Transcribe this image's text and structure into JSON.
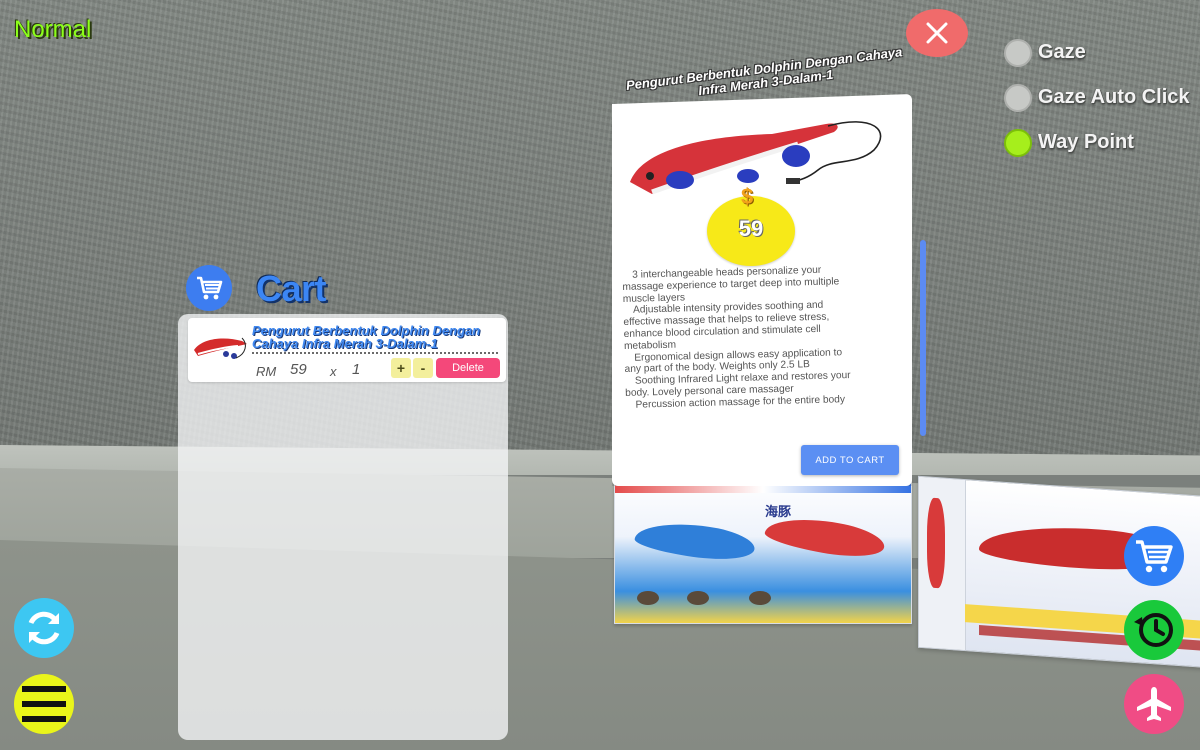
{
  "mode": {
    "current": "Normal"
  },
  "close": {
    "label": "X"
  },
  "mode_options": [
    {
      "label": "Gaze",
      "active": false
    },
    {
      "label": "Gaze Auto Click",
      "active": false
    },
    {
      "label": "Way Point",
      "active": true
    }
  ],
  "cart": {
    "title": "Cart",
    "items": [
      {
        "name": "Pengurut Berbentuk Dolphin Dengan Cahaya Infra Merah 3-Dalam-1",
        "currency": "RM",
        "price": "59",
        "times": "x",
        "quantity": "1",
        "plus_label": "+",
        "minus_label": "-",
        "delete_label": "Delete"
      }
    ]
  },
  "product": {
    "title": "Pengurut Berbentuk Dolphin Dengan Cahaya Infra Merah 3-Dalam-1",
    "price_symbol": "$",
    "price": "59",
    "description": [
      "3 interchangeable heads personalize your",
      "massage experience to target deep into multiple",
      "muscle layers",
      "Adjustable intensity provides soothing and",
      "effective massage that helps to relieve stress,",
      "enhance blood circulation and stimulate cell",
      "metabolism",
      "Ergonomical design allows easy application to",
      "any part of the body. Weights only 2.5 LB",
      "Soothing Infrared Light relaxe and restores your",
      "body. Lovely personal care massager",
      "Percussion action massage for the entire body"
    ],
    "add_to_cart_label": "ADD TO CART"
  },
  "icons": {
    "cart": "cart-icon",
    "history": "history-icon",
    "teleport": "airplane-icon",
    "refresh": "refresh-icon",
    "menu": "menu-icon"
  },
  "colors": {
    "mode_label": "#8cff1a",
    "cart_blue": "#3c86f4",
    "delete": "#f4487a",
    "add_to_cart": "#5b8ff3",
    "price_bubble": "#f7e918",
    "close": "#f06b6b"
  }
}
